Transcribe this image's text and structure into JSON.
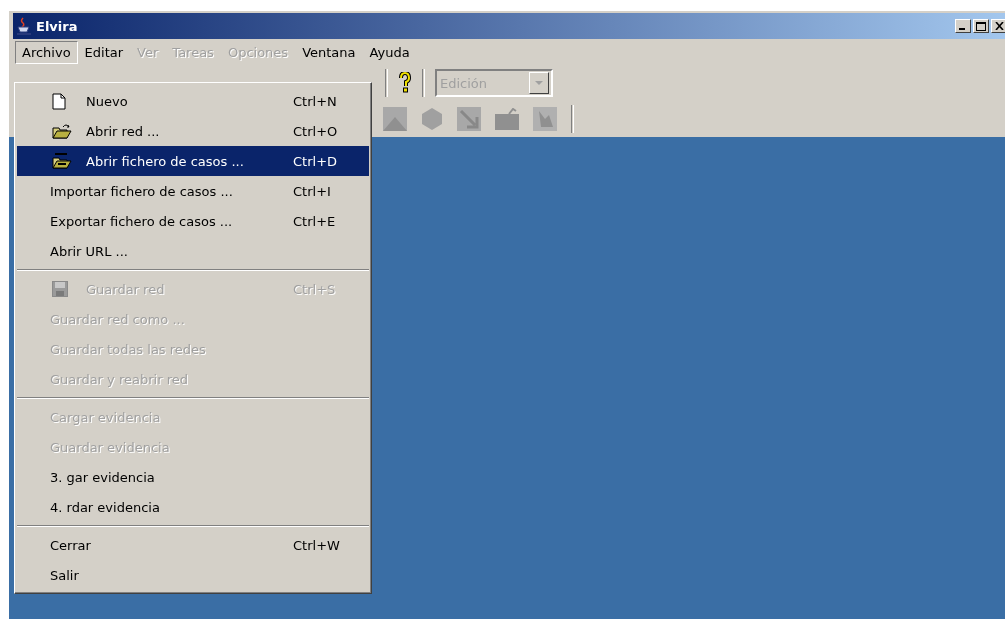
{
  "window": {
    "title": "Elvira"
  },
  "menubar": [
    {
      "label": "Archivo",
      "selected": true,
      "disabled": false
    },
    {
      "label": "Editar",
      "selected": false,
      "disabled": false
    },
    {
      "label": "Ver",
      "selected": false,
      "disabled": true
    },
    {
      "label": "Tareas",
      "selected": false,
      "disabled": true
    },
    {
      "label": "Opciones",
      "selected": false,
      "disabled": true
    },
    {
      "label": "Ventana",
      "selected": false,
      "disabled": false
    },
    {
      "label": "Ayuda",
      "selected": false,
      "disabled": false
    }
  ],
  "toolbar": {
    "mode_combo": {
      "value": "Edición",
      "disabled": true
    }
  },
  "menu": {
    "items": [
      {
        "kind": "item",
        "label": "Nuevo",
        "shortcut": "Ctrl+N",
        "disabled": false,
        "selected": false
      },
      {
        "kind": "item",
        "label": "Abrir red ...",
        "shortcut": "Ctrl+O",
        "disabled": false,
        "selected": false
      },
      {
        "kind": "item",
        "label": "Abrir fichero de casos ...",
        "shortcut": "Ctrl+D",
        "disabled": false,
        "selected": true
      },
      {
        "kind": "item",
        "label": "Importar fichero de casos ...",
        "shortcut": "Ctrl+I",
        "disabled": false,
        "selected": false
      },
      {
        "kind": "item",
        "label": "Exportar fichero de casos ...",
        "shortcut": "Ctrl+E",
        "disabled": false,
        "selected": false
      },
      {
        "kind": "item",
        "label": "Abrir URL ...",
        "disabled": false,
        "selected": false
      },
      {
        "kind": "separator"
      },
      {
        "kind": "item",
        "label": "Guardar red",
        "shortcut": "Ctrl+S",
        "disabled": true,
        "selected": false
      },
      {
        "kind": "item",
        "label": "Guardar red como ...",
        "disabled": true,
        "selected": false
      },
      {
        "kind": "item",
        "label": "Guardar todas las redes",
        "disabled": true,
        "selected": false
      },
      {
        "kind": "item",
        "label": "Guardar y reabrir red",
        "disabled": true,
        "selected": false
      },
      {
        "kind": "separator"
      },
      {
        "kind": "item",
        "label": "Cargar evidencia",
        "disabled": true,
        "selected": false
      },
      {
        "kind": "item",
        "label": "Guardar evidencia",
        "disabled": true,
        "selected": false
      },
      {
        "kind": "item",
        "label": "3. gar evidencia",
        "disabled": false,
        "selected": false
      },
      {
        "kind": "item",
        "label": "4. rdar evidencia",
        "disabled": false,
        "selected": false
      },
      {
        "kind": "separator"
      },
      {
        "kind": "item",
        "label": "Cerrar",
        "shortcut": "Ctrl+W",
        "disabled": false,
        "selected": false
      },
      {
        "kind": "item",
        "label": "Salir",
        "disabled": false,
        "selected": false
      }
    ]
  }
}
